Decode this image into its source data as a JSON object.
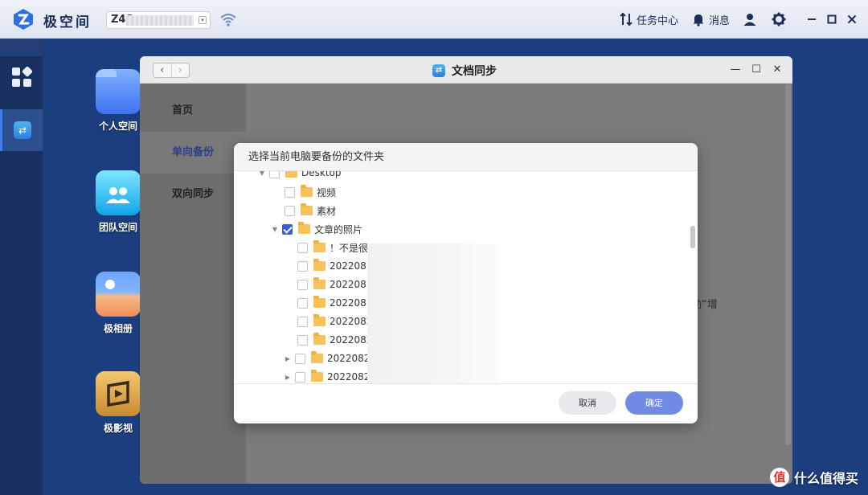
{
  "topbar": {
    "brand": "极空间",
    "device_name": "Z4S",
    "task_center_label": "任务中心",
    "messages_label": "消息"
  },
  "desktop": {
    "icons": [
      {
        "label": "个人空间",
        "icon": "blue-folder-icon"
      },
      {
        "label": "团队空间",
        "icon": "team-folder-icon"
      },
      {
        "label": "极相册",
        "icon": "photo-album-icon"
      },
      {
        "label": "极影视",
        "icon": "video-icon"
      }
    ]
  },
  "window": {
    "title": "文档同步",
    "sidebar": {
      "items": [
        {
          "label": "首页"
        },
        {
          "label": "单向备份",
          "active": true
        },
        {
          "label": "双向同步"
        }
      ]
    },
    "content_fragment": "动“增"
  },
  "dialog": {
    "title": "选择当前电脑要备份的文件夹",
    "tree": [
      {
        "label": "Desktop",
        "level": 0,
        "expanded": true,
        "checked": false
      },
      {
        "label": "视频",
        "level": 1,
        "checked": false
      },
      {
        "label": "素材",
        "level": 1,
        "checked": false
      },
      {
        "label": "文章的照片",
        "level": 1,
        "expanded": true,
        "checked": true
      },
      {
        "label": "！不是很重",
        "level": 2,
        "checked": false
      },
      {
        "label": "20220810",
        "level": 2,
        "checked": false
      },
      {
        "label": "20220813",
        "level": 2,
        "checked": false
      },
      {
        "label": "20220813",
        "level": 2,
        "checked": false
      },
      {
        "label": "20220820",
        "level": 2,
        "checked": false
      },
      {
        "label": "20220822",
        "level": 2,
        "checked": false
      },
      {
        "label": "20220824",
        "level": 2,
        "collapsed": true,
        "checked": false
      },
      {
        "label": "20220825",
        "level": 2,
        "collapsed": true,
        "checked": false
      }
    ],
    "cancel_label": "取消",
    "ok_label": "确定"
  },
  "watermark": {
    "logo_char": "值",
    "text": "什么值得买"
  },
  "colors": {
    "accent": "#3b5bdb",
    "ok_button": "#6f8be3",
    "desktop_bg": "#1b3e7e"
  }
}
